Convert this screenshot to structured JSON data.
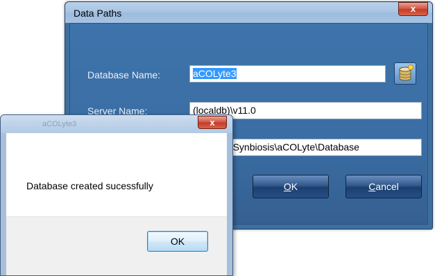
{
  "data_paths_dialog": {
    "title": "Data Paths",
    "close_glyph": "x",
    "database_name": {
      "label": "Database Name:",
      "value": "aCOLyte3",
      "picker_icon": "database-icon"
    },
    "server_name": {
      "label": "Server Name:",
      "value": "(localdb)\\v11.0"
    },
    "path": {
      "value": "ramData\\Synbiosis\\aCOLyte\\Database"
    },
    "ok_button": {
      "accel": "O",
      "rest": "K"
    },
    "cancel_button": {
      "accel": "C",
      "rest": "ancel"
    }
  },
  "message_box": {
    "title_ghost": "aCOLyte3",
    "close_glyph": "x",
    "message": "Database created sucessfully",
    "ok_label": "OK"
  },
  "colors": {
    "frame_blue": "#3d6f9f",
    "close_red": "#c43c27",
    "selection_blue": "#3399ff"
  }
}
